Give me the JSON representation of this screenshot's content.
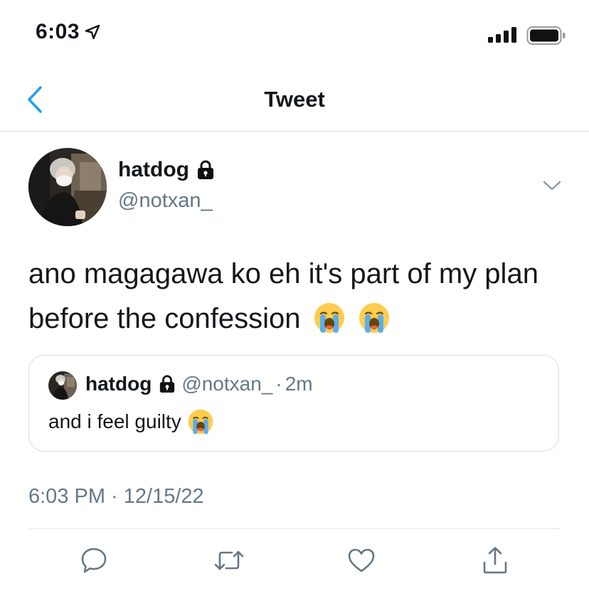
{
  "status_bar": {
    "time": "6:03"
  },
  "nav": {
    "title": "Tweet"
  },
  "tweet": {
    "author_name": "hatdog",
    "author_handle": "@notxan_",
    "text": "ano magagawa ko eh it's part of my plan before the confession",
    "timestamp": "6:03 PM · 12/15/22"
  },
  "quote": {
    "author_name": "hatdog",
    "author_handle": "@notxan_",
    "separator": "·",
    "time": "2m",
    "text": "and i feel guilty"
  },
  "icons": {
    "location": "location-arrow-icon",
    "signal": "cellular-signal-icon",
    "battery": "battery-icon",
    "back": "chevron-left-icon",
    "lock": "lock-icon",
    "more": "chevron-down-icon",
    "emoji": "loudly-crying-face-emoji",
    "reply": "reply-icon",
    "retweet": "retweet-icon",
    "like": "heart-icon",
    "share": "share-icon"
  },
  "colors": {
    "accent": "#1da1f2",
    "secondary_text": "#657786",
    "divider": "#d5dbe0"
  }
}
